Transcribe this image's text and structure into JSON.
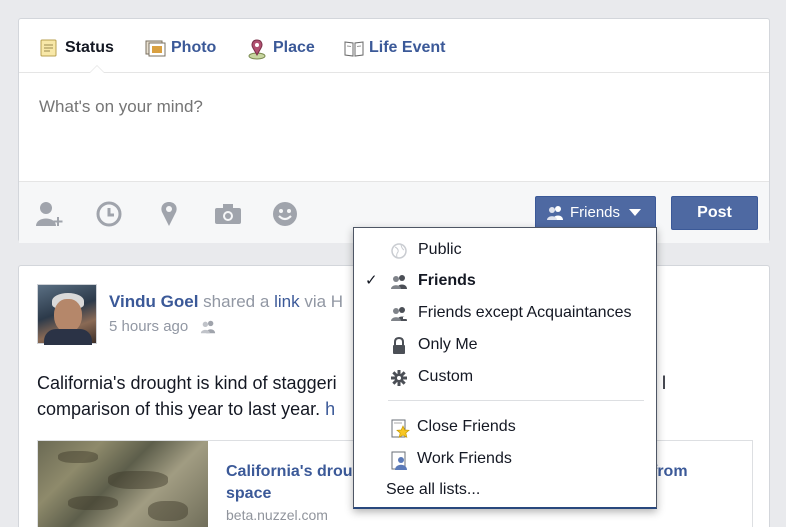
{
  "composer": {
    "tabs": [
      {
        "label": "Status",
        "icon": "status-icon"
      },
      {
        "label": "Photo",
        "icon": "photo-icon"
      },
      {
        "label": "Place",
        "icon": "place-pin-icon"
      },
      {
        "label": "Life Event",
        "icon": "life-event-book-icon"
      }
    ],
    "placeholder": "What's on your mind?",
    "tools": [
      "tag-friends-icon",
      "clock-icon",
      "location-pin-icon",
      "camera-icon",
      "smiley-icon"
    ],
    "audience_label": "Friends",
    "post_label": "Post"
  },
  "story": {
    "author": "Vindu Goel",
    "action_prefix": "shared a",
    "action_link": "link",
    "action_suffix": "via H",
    "time": "5 hours ago",
    "text_line1": "California's drought is kind of staggeri",
    "text_line1_end": "l",
    "text_line2": "comparison of this year to last year.",
    "text_line2_link": "h",
    "link_title_start": "California's drou",
    "link_title_end": "from",
    "link_title_line2": "space",
    "link_domain": "beta.nuzzel.com"
  },
  "dropdown": {
    "options": [
      {
        "label": "Public",
        "icon": "globe-icon",
        "selected": false
      },
      {
        "label": "Friends",
        "icon": "friends-icon",
        "selected": true
      },
      {
        "label": "Friends except Acquaintances",
        "icon": "friends-except-icon",
        "selected": false
      },
      {
        "label": "Only Me",
        "icon": "lock-icon",
        "selected": false
      },
      {
        "label": "Custom",
        "icon": "gear-icon",
        "selected": false
      }
    ],
    "check_mark": "✓",
    "lists": [
      {
        "label": "Close Friends",
        "icon": "star-list-icon"
      },
      {
        "label": "Work Friends",
        "icon": "work-list-icon"
      }
    ],
    "see_all": "See all lists..."
  },
  "colors": {
    "brand_blue": "#3b5998",
    "button_blue": "#4e69a2",
    "background": "#e9eaed"
  }
}
